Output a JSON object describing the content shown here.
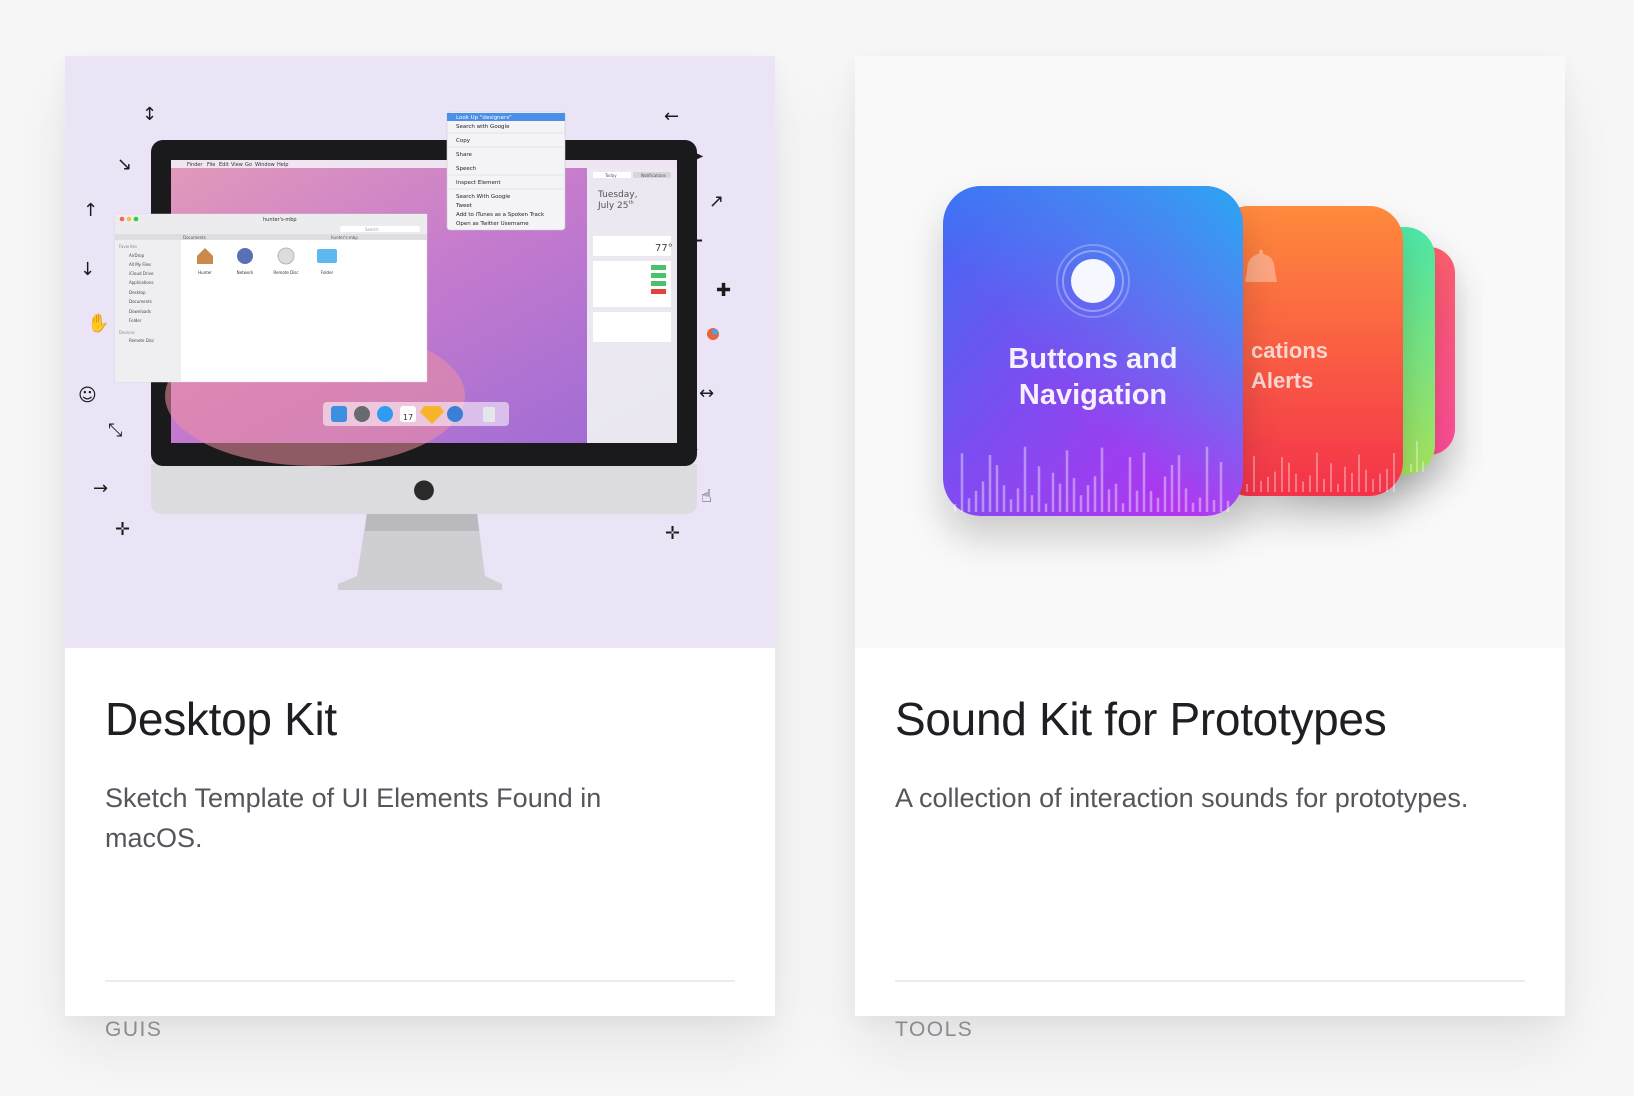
{
  "cards": [
    {
      "title": "Desktop Kit",
      "description": "Sketch Template of UI Elements Found in macOS.",
      "tag": "GUIS",
      "hero": {
        "context_menu": [
          "Look Up \"designers\"",
          "Search with Google",
          "Copy",
          "Share",
          "Speech",
          "Inspect Element",
          "Search With Google",
          "Tweet",
          "Add to iTunes as a Spoken Track",
          "Open as Twitter Username"
        ],
        "menubar": [
          "Finder",
          "File",
          "Edit",
          "View",
          "Go",
          "Window",
          "Help"
        ],
        "finder_title": "hunter's-mbp",
        "finder_search": "Search",
        "finder_tabs": [
          "Documents",
          "hunter's-mbp"
        ],
        "finder_sidebar_fav_header": "Favorites",
        "finder_sidebar_favorites": [
          "AirDrop",
          "All My Files",
          "iCloud Drive",
          "Applications",
          "Desktop",
          "Documents",
          "Downloads",
          "Folder"
        ],
        "finder_sidebar_dev_header": "Devices",
        "finder_sidebar_devices": [
          "Remote Disc"
        ],
        "finder_items": [
          "Hunter",
          "Network",
          "Remote Disc",
          "Folder"
        ],
        "notification_day": "Tuesday,",
        "notification_date": "July 25",
        "notification_date_sup": "th",
        "notification_tabs": [
          "Today",
          "Notifications"
        ],
        "weather_temp": "77°",
        "calendar_day": "17"
      }
    },
    {
      "title": "Sound Kit for Prototypes",
      "description": "A collection of interaction sounds for prototypes.",
      "tag": "TOOLS",
      "hero": {
        "front_card_line1": "Buttons and",
        "front_card_line2": "Navigation",
        "second_card_line1": "cations",
        "second_card_line2": "Alerts"
      }
    }
  ]
}
